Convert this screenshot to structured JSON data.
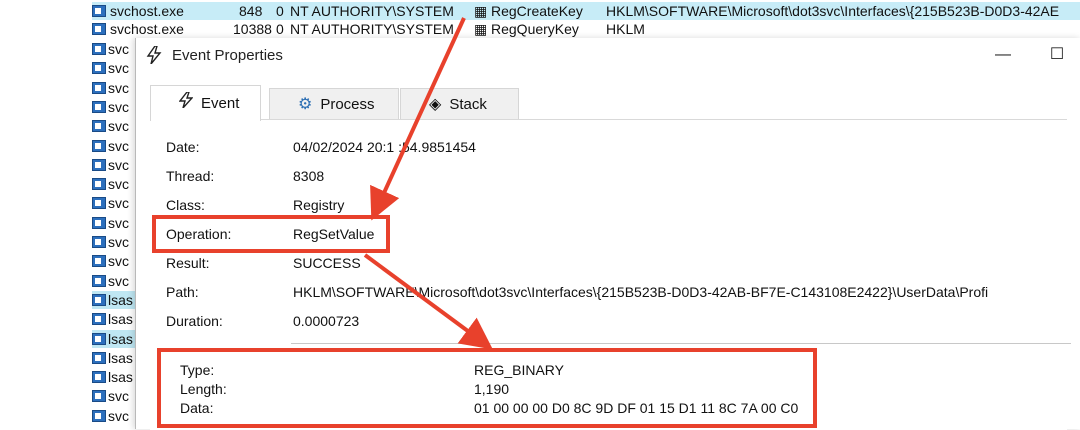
{
  "process_list": {
    "top_rows": [
      {
        "name": "svchost.exe",
        "pid": "848",
        "zero": "0",
        "user": "NT AUTHORITY\\SYSTEM",
        "op": "RegCreateKey",
        "path": "HKLM\\SOFTWARE\\Microsoft\\dot3svc\\Interfaces\\{215B523B-D0D3-42AE"
      },
      {
        "name": "svchost.exe",
        "pid": "10388",
        "zero": "0",
        "user": "NT AUTHORITY\\SYSTEM",
        "op": "RegQueryKey",
        "path": "HKLM"
      }
    ],
    "side_rows": [
      "svc",
      "svc",
      "svc",
      "svc",
      "svc",
      "svc",
      "svc",
      "svc",
      "svc",
      "svc",
      "svc",
      "svc",
      "svc",
      "lsas",
      "lsas",
      "lsas",
      "lsas",
      "lsas",
      "svc",
      "svc"
    ]
  },
  "dialog": {
    "title": "Event Properties",
    "minimize": "—",
    "maximize": "☐",
    "tabs": [
      {
        "label": "Event",
        "icon": "lightning-icon"
      },
      {
        "label": "Process",
        "icon": "gear-icon"
      },
      {
        "label": "Stack",
        "icon": "layers-icon"
      }
    ],
    "fields": [
      {
        "label": "Date:",
        "value": "04/02/2024 20:1 :54.9851454"
      },
      {
        "label": "Thread:",
        "value": "8308"
      },
      {
        "label": "Class:",
        "value": "Registry"
      },
      {
        "label": "Operation:",
        "value": "RegSetValue"
      },
      {
        "label": "Result:",
        "value": "SUCCESS"
      },
      {
        "label": "Path:",
        "value": "HKLM\\SOFTWARE\\Microsoft\\dot3svc\\Interfaces\\{215B523B-D0D3-42AB-BF7E-C143108E2422}\\UserData\\Profi"
      },
      {
        "label": "Duration:",
        "value": "0.0000723"
      }
    ],
    "details": [
      {
        "label": "Type:",
        "value": "REG_BINARY"
      },
      {
        "label": "Length:",
        "value": "1,190"
      },
      {
        "label": "Data:",
        "value": "01 00 00 00 D0 8C 9D DF 01 15 D1 11 8C 7A 00 C0"
      }
    ]
  },
  "colors": {
    "annotation": "#e8412c",
    "highlight_row": "#bfe7f3"
  }
}
